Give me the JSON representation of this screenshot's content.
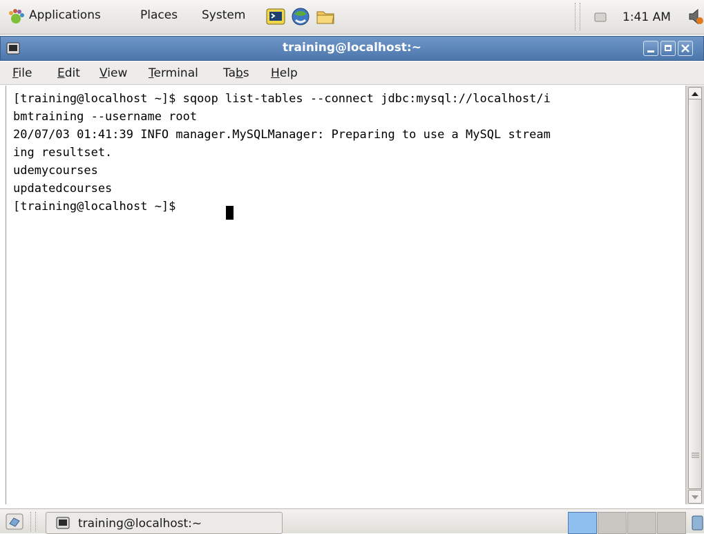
{
  "top_panel": {
    "menus": [
      "Applications",
      "Places",
      "System"
    ],
    "launchers": [
      "terminal-launcher-icon",
      "web-browser-icon",
      "folder-icon"
    ],
    "clock": "1:41 AM"
  },
  "window": {
    "title": "training@localhost:~",
    "menubar": [
      {
        "label": "File",
        "mnemonic": "F"
      },
      {
        "label": "Edit",
        "mnemonic": "E"
      },
      {
        "label": "View",
        "mnemonic": "V"
      },
      {
        "label": "Terminal",
        "mnemonic": "T"
      },
      {
        "label": "Tabs",
        "mnemonic": "b"
      },
      {
        "label": "Help",
        "mnemonic": "H"
      }
    ]
  },
  "terminal": {
    "lines": [
      "[training@localhost ~]$ sqoop list-tables --connect jdbc:mysql://localhost/i",
      "bmtraining --username root",
      "20/07/03 01:41:39 INFO manager.MySQLManager: Preparing to use a MySQL stream",
      "ing resultset.",
      "udemycourses",
      "updatedcourses",
      "[training@localhost ~]$ "
    ]
  },
  "taskbar": {
    "task_label": "training@localhost:~",
    "workspaces": 4,
    "active_workspace": 1
  },
  "colors": {
    "titlebar": "#5a82b7",
    "panel": "#e8e6e2",
    "workspace_active": "#8fbfee",
    "workspace_inactive": "#c9c7c2"
  }
}
